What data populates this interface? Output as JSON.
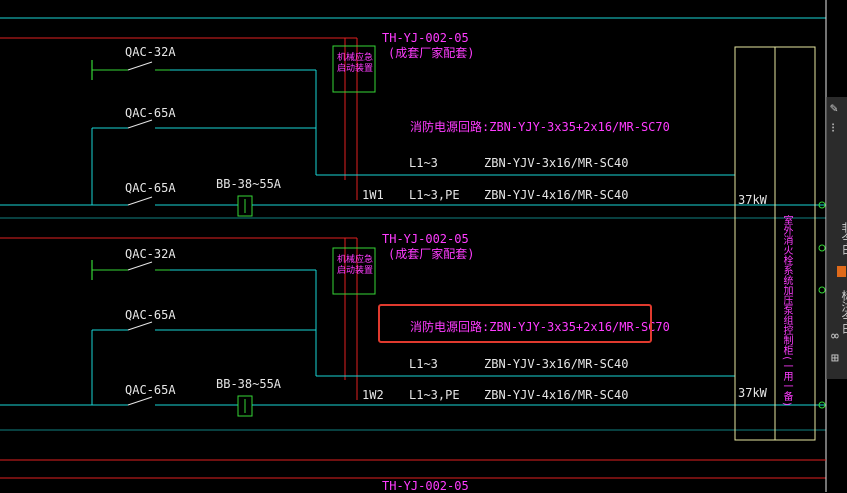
{
  "diagram": {
    "panel1": {
      "device_code": "TH-YJ-002-05",
      "device_note": "(成套厂家配套)",
      "box_label": "机械应急启动装置",
      "breakers": [
        "QAC-32A",
        "QAC-65A",
        "QAC-65A"
      ],
      "contactor": "BB-38~55A",
      "circuit": "1W1",
      "cable_main": "消防电源回路:ZBN-YJY-3x35+2x16/MR-SC70",
      "phase_1": "L1~3",
      "cable_1": "ZBN-YJV-3x16/MR-SC40",
      "phase_2": "L1~3,PE",
      "cable_2": "ZBN-YJV-4x16/MR-SC40",
      "power": "37kW"
    },
    "panel2": {
      "device_code": "TH-YJ-002-05",
      "device_note": "(成套厂家配套)",
      "box_label": "机械应急启动装置",
      "breakers": [
        "QAC-32A",
        "QAC-65A",
        "QAC-65A"
      ],
      "contactor": "BB-38~55A",
      "circuit": "1W2",
      "cable_main": "消防电源回路:ZBN-YJY-3x35+2x16/MR-SC70",
      "phase_1": "L1~3",
      "cable_1": "ZBN-YJV-3x16/MR-SC40",
      "phase_2": "L1~3,PE",
      "cable_2": "ZBN-YJV-4x16/MR-SC40",
      "power": "37kW"
    },
    "panel3": {
      "device_code": "TH-YJ-002-05"
    },
    "load_label": "室外消火栓系统加压泵组控制柜(一用一备)"
  },
  "toolbar": {
    "text_1": "非今日",
    "text_2": "标注今日"
  },
  "colors": {
    "background": "#000000",
    "wire_cyan": "#19d4d4",
    "wire_red": "#e02020",
    "breaker_green": "#36d636",
    "text_magenta": "#ff3cff",
    "text_white": "#e6e6e6",
    "box_yellow": "#e6e6a0",
    "highlight_red": "#e03a2e"
  }
}
